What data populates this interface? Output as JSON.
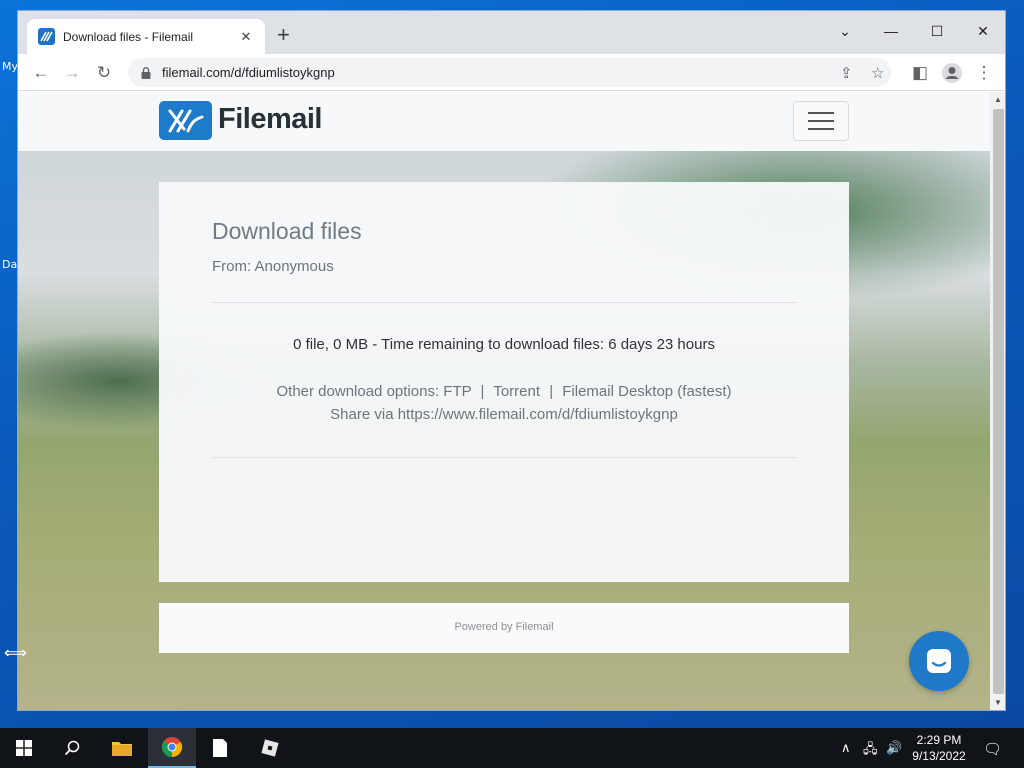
{
  "desktop": {
    "labels": [
      "My",
      "Da"
    ]
  },
  "browser": {
    "tab_title": "Download files - Filemail",
    "tab_close": "✕",
    "new_tab": "+",
    "url": "filemail.com/d/fdiumlistoykgnp",
    "window_controls": {
      "dropdown": "⌄",
      "minimize": "—",
      "maximize": "☐",
      "close": "✕"
    },
    "nav": {
      "back": "←",
      "forward": "→",
      "reload": "↻"
    },
    "omnibox_icons": {
      "share": "⇪",
      "star": "☆",
      "sidepanel": "◧",
      "menu": "⋮"
    }
  },
  "site": {
    "logo_text": "Filemail"
  },
  "download_card": {
    "title": "Download files",
    "from": "From: Anonymous",
    "summary": "0 file, 0 MB - Time remaining to download files: 6 days 23 hours",
    "options_prefix": "Other download options:",
    "options": [
      "FTP",
      "Torrent",
      "Filemail Desktop (fastest)"
    ],
    "separator": "|",
    "share_prefix": "Share via",
    "share_url": "https://www.filemail.com/d/fdiumlistoykgnp"
  },
  "footer": {
    "powered_by": "Powered by Filemail"
  },
  "taskbar": {
    "clock_time": "2:29 PM",
    "clock_date": "9/13/2022"
  },
  "colors": {
    "brand": "#1e7bc9",
    "taskbar": "#101318",
    "desktop": "#0a5dc2"
  }
}
